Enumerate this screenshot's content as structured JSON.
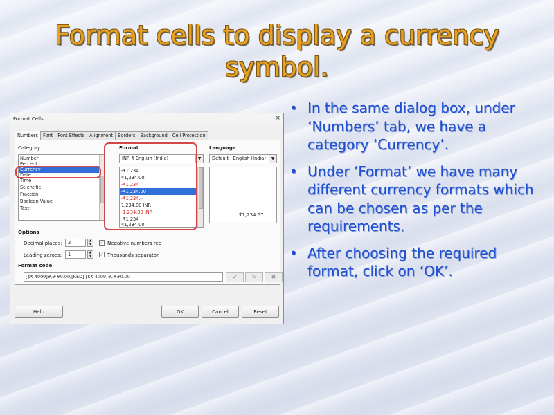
{
  "slide": {
    "title": "Format cells to display a currency symbol.",
    "bullets": [
      "In the same dialog box, under ‘Numbers’ tab, we have a category ‘Currency’.",
      "Under ‘Format’ we have many different currency formats which can be chosen as per the requirements.",
      "After choosing the required format, click on ‘OK’."
    ],
    "bullet_char": "•",
    "colors": {
      "title": "#e8a020",
      "bullets": "#2050d0",
      "highlight": "#d04848"
    }
  },
  "dialog": {
    "title": "Format Cells",
    "close_icon": "×",
    "tabs": [
      "Numbers",
      "Font",
      "Font Effects",
      "Alignment",
      "Borders",
      "Background",
      "Cell Protection"
    ],
    "active_tab": "Numbers",
    "category": {
      "label": "Category",
      "items": [
        "Number",
        "Percent",
        "Currency",
        "Date",
        "Time",
        "Scientific",
        "Fraction",
        "Boolean Value",
        "Text"
      ],
      "selected": "Currency"
    },
    "format": {
      "label": "Format",
      "currency_combo": "INR ₹ English (India)",
      "items": [
        "-₹1,234",
        "₹1,234.00",
        "-₹1,234",
        "-₹1,234.00",
        "-₹1,234.--",
        "1,234.00 INR",
        "-1,234.00 INR",
        "-₹1,234",
        "₹1,234.00"
      ],
      "red_items": [
        2,
        4,
        6
      ],
      "selected_index": 3
    },
    "language": {
      "label": "Language",
      "value": "Default - English (India)",
      "preview": "₹1,234.57"
    },
    "options": {
      "label": "Options",
      "decimal_label": "Decimal places:",
      "decimal_value": "2",
      "leading_label": "Leading zeroes:",
      "leading_value": "1",
      "negative_red_label": "Negative numbers red",
      "negative_red_checked": true,
      "thousands_label": "Thousands separator",
      "thousands_checked": true
    },
    "format_code": {
      "label": "Format code",
      "value": "[$₹-4009]#,##0.00;[RED]-[$₹-4009]#,##0.00"
    },
    "buttons": {
      "help": "Help",
      "ok": "OK",
      "cancel": "Cancel",
      "reset": "Reset"
    }
  }
}
